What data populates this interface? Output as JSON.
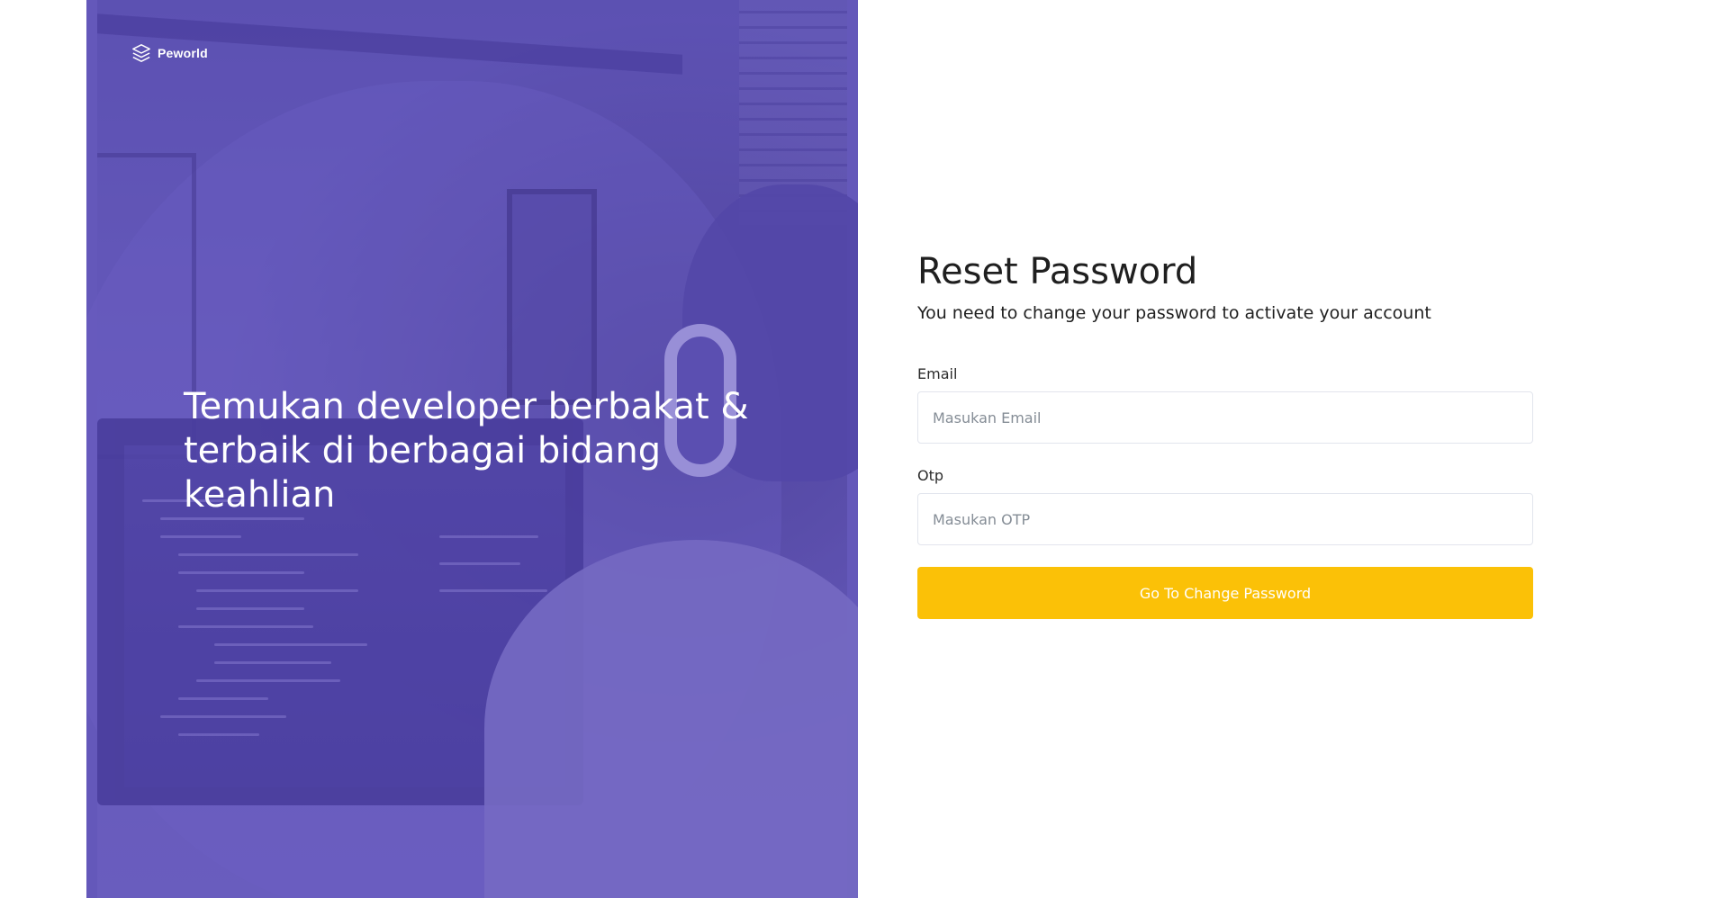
{
  "brand": {
    "name": "Peworld",
    "icon": "layers-icon"
  },
  "hero": {
    "headline": "Temukan developer berbakat & terbaik di berbagai bidang keahlian"
  },
  "form": {
    "title": "Reset Password",
    "subtitle": "You need to change your password to activate your account",
    "email": {
      "label": "Email",
      "placeholder": "Masukan Email",
      "value": ""
    },
    "otp": {
      "label": "Otp",
      "placeholder": "Masukan OTP",
      "value": ""
    },
    "submit_label": "Go To Change Password"
  },
  "colors": {
    "hero_overlay": "#5e50be",
    "primary_button": "#fbc107",
    "input_border": "#e2e5ed",
    "text_dark": "#1f1f1f"
  }
}
